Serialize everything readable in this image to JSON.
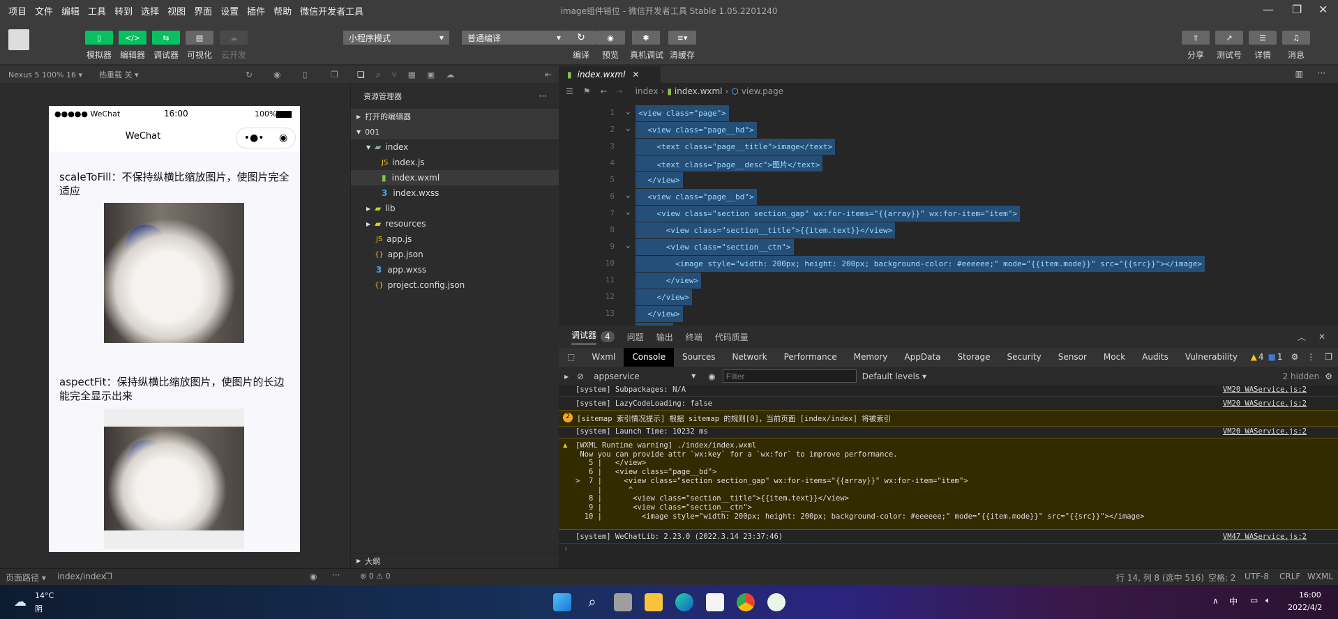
{
  "menu": [
    "项目",
    "文件",
    "编辑",
    "工具",
    "转到",
    "选择",
    "视图",
    "界面",
    "设置",
    "插件",
    "帮助",
    "微信开发者工具"
  ],
  "window_title": "image组件错位 - 微信开发者工具 Stable 1.05.2201240",
  "toolbar": {
    "simulator": "模拟器",
    "editor": "编辑器",
    "debugger": "调试器",
    "visual": "可视化",
    "cloud": "云开发",
    "mode": "小程序模式",
    "compile_mode": "普通编译",
    "compile": "编译",
    "preview": "预览",
    "remote_debug": "真机调试",
    "clear_cache": "清缓存",
    "share": "分享",
    "test_id": "测试号",
    "details": "详情",
    "messages": "消息"
  },
  "sim": {
    "device": "Nexus 5 100% 16 ▾",
    "hot_reload": "热重载 关 ▾",
    "carrier": "●●●●● WeChat",
    "time": "16:00",
    "battery": "100%",
    "nav_title": "WeChat",
    "sections": [
      {
        "title": "scaleToFill：不保持纵横比缩放图片，使图片完全适应"
      },
      {
        "title": "aspectFit：保持纵横比缩放图片，使图片的长边能完全显示出来"
      }
    ]
  },
  "explorer": {
    "title": "资源管理器",
    "open_editors": "打开的编辑器",
    "project": "001",
    "outline": "大纲",
    "items": [
      "index",
      "index.js",
      "index.wxml",
      "index.wxss",
      "lib",
      "resources",
      "app.js",
      "app.json",
      "app.wxss",
      "project.config.json"
    ]
  },
  "editor": {
    "tab": "index.wxml",
    "breadcrumb": [
      "index",
      "index.wxml",
      "view.page"
    ],
    "lines": [
      "<view class=\"page\">",
      "  <view class=\"page__hd\">",
      "    <text class=\"page__title\">image</text>",
      "    <text class=\"page__desc\">图片</text>",
      "  </view>",
      "  <view class=\"page__bd\">",
      "    <view class=\"section section_gap\" wx:for-items=\"{{array}}\" wx:for-item=\"item\">",
      "      <view class=\"section__title\">{{item.text}}</view>",
      "      <view class=\"section__ctn\">",
      "        <image style=\"width: 200px; height: 200px; background-color: #eeeeee;\" mode=\"{{item.mode}}\" src=\"{{src}}\"></image>",
      "      </view>",
      "    </view>",
      "  </view>",
      "</view>"
    ]
  },
  "debugger": {
    "tabs": [
      "调试器",
      "问题",
      "输出",
      "终端",
      "代码质量"
    ],
    "badge": "4",
    "devtools_tabs": [
      "Wxml",
      "Console",
      "Sources",
      "Network",
      "Performance",
      "Memory",
      "AppData",
      "Storage",
      "Security",
      "Sensor",
      "Mock",
      "Audits",
      "Vulnerability"
    ],
    "warn_count": "4",
    "info_count": "1",
    "context": "appservice",
    "filter_placeholder": "Filter",
    "levels": "Default levels ▾",
    "hidden": "2 hidden",
    "logs": [
      {
        "text": "[system] Subpackages: N/A",
        "src": "VM20 WAService.js:2"
      },
      {
        "text": "[system] LazyCodeLoading: false",
        "src": "VM20 WAService.js:2"
      },
      {
        "text": "[sitemap 索引情况提示] 根据 sitemap 的规则[0]，当前页面 [index/index] 将被索引",
        "count": "2"
      },
      {
        "text": "[system] Launch Time: 10232 ms",
        "src": "VM20 WAService.js:2"
      },
      {
        "text": "[WXML Runtime warning] ./index/index.wxml\n Now you can provide attr `wx:key` for a `wx:for` to improve performance.\n   5 |   </view>\n   6 |   <view class=\"page__bd\">\n>  7 |     <view class=\"section section_gap\" wx:for-items=\"{{array}}\" wx:for-item=\"item\">\n     |      ^\n   8 |       <view class=\"section__title\">{{item.text}}</view>\n   9 |       <view class=\"section__ctn\">\n  10 |         <image style=\"width: 200px; height: 200px; background-color: #eeeeee;\" mode=\"{{item.mode}}\" src=\"{{src}}\"></image>"
      },
      {
        "text": "[system] WeChatLib: 2.23.0 (2022.3.14 23:37:46)",
        "src": "VM47 WAService.js:2"
      }
    ]
  },
  "status": {
    "page_path": "页面路径 ▾",
    "path": "index/index",
    "problems": "⊗ 0 ⚠ 0",
    "position": "行 14, 列 8 (选中 516)",
    "spaces": "空格: 2",
    "encoding": "UTF-8",
    "eol": "CRLF",
    "lang": "WXML"
  },
  "taskbar": {
    "temp": "14°C",
    "weather": "阴",
    "time": "16:00",
    "date": "2022/4/2",
    "ime": "中"
  },
  "colors": {
    "accent": "#07c160",
    "selection": "#264f78"
  }
}
